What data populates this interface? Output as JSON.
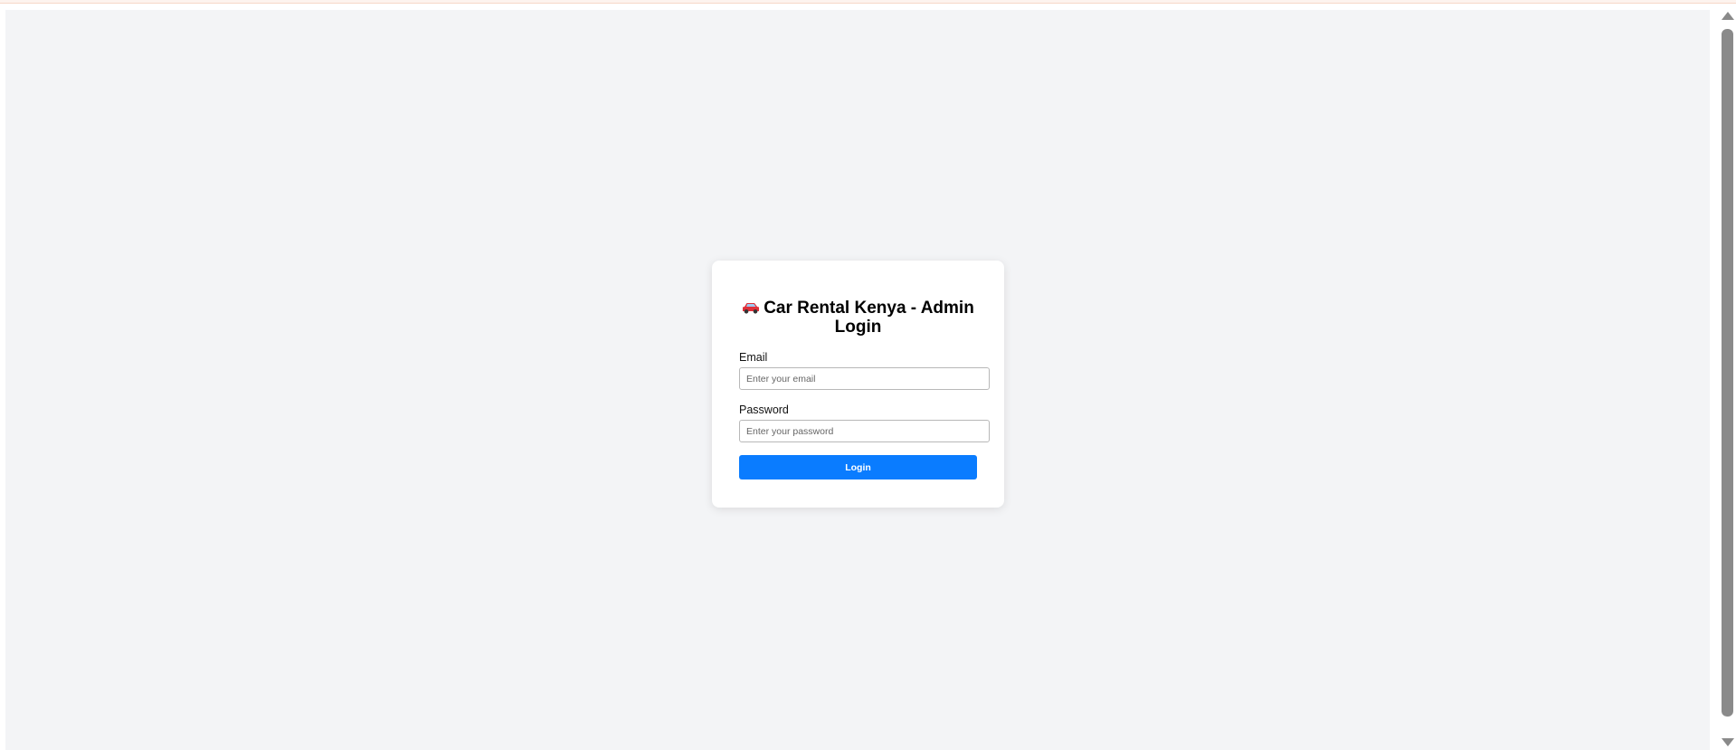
{
  "login": {
    "title": "Car Rental Kenya - Admin Login",
    "icon": "car-icon",
    "email_label": "Email",
    "email_placeholder": "Enter your email",
    "email_value": "",
    "password_label": "Password",
    "password_placeholder": "Enter your password",
    "password_value": "",
    "submit_label": "Login"
  },
  "colors": {
    "page_background": "#f3f4f6",
    "card_background": "#ffffff",
    "button": "#0a7cff",
    "icon": "#e0303a"
  }
}
